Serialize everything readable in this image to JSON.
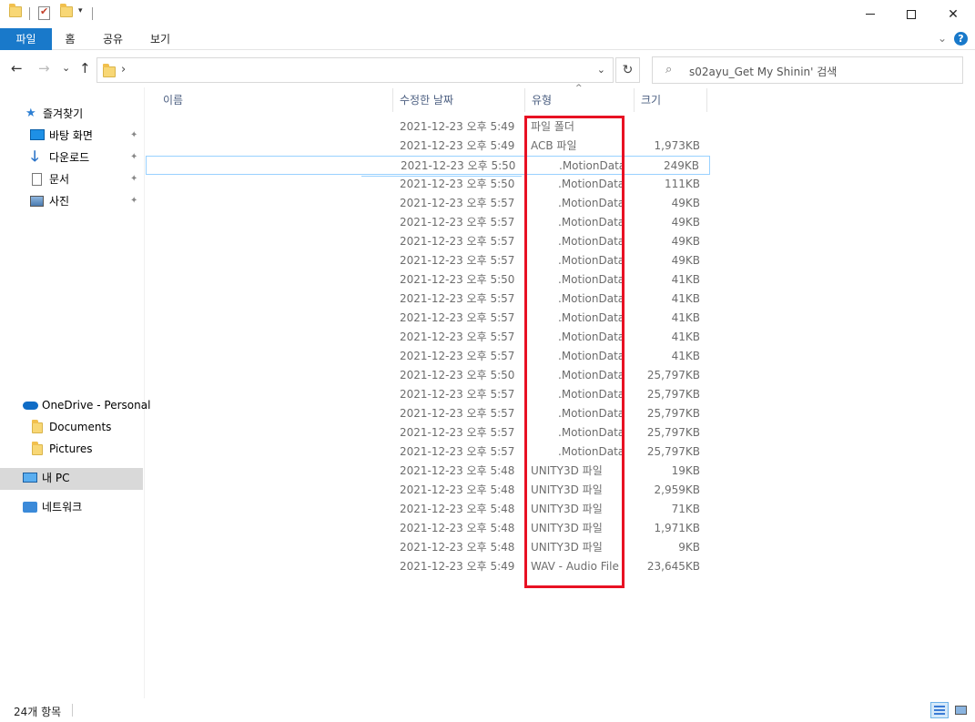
{
  "titlebar": {
    "qa_dropdown": "▾",
    "min_label": "",
    "close_label": "✕"
  },
  "ribbon": {
    "tabs": [
      {
        "label": "파일"
      },
      {
        "label": "홈"
      },
      {
        "label": "공유"
      },
      {
        "label": "보기"
      }
    ],
    "expand_glyph": "⌄",
    "help_glyph": "?"
  },
  "nav": {
    "back": "←",
    "forward": "→",
    "recent": "⌄",
    "up": "↑",
    "breadcrumb_chevron": "›",
    "address_dropdown": "⌄",
    "refresh": "↻",
    "search_glyph": "⌕",
    "search_placeholder": "s02ayu_Get My Shinin' 검색"
  },
  "sidebar": {
    "quick_access": "즐겨찾기",
    "pinned": [
      {
        "label": "바탕 화면",
        "icon": "desktop-icon"
      },
      {
        "label": "다운로드",
        "icon": "download-icon"
      },
      {
        "label": "문서",
        "icon": "document-icon"
      },
      {
        "label": "사진",
        "icon": "pictures-icon"
      }
    ],
    "pin_glyph": "📌",
    "onedrive": "OneDrive - Personal",
    "onedrive_children": [
      {
        "label": "Documents"
      },
      {
        "label": "Pictures"
      }
    ],
    "this_pc": "내 PC",
    "network": "네트워크"
  },
  "columns": {
    "name": "이름",
    "date": "수정한 날짜",
    "type": "유형",
    "size": "크기",
    "sort_glyph": "^"
  },
  "files": [
    {
      "date": "2021-12-23 오후 5:49",
      "type": "파일 폴더",
      "size": ""
    },
    {
      "date": "2021-12-23 오후 5:49",
      "type": "ACB 파일",
      "size": "1,973KB"
    },
    {
      "date": "2021-12-23 오후 5:50",
      "type": ".MotionData",
      "size": "249KB"
    },
    {
      "date": "2021-12-23 오후 5:50",
      "type": ".MotionData",
      "size": "111KB"
    },
    {
      "date": "2021-12-23 오후 5:57",
      "type": ".MotionData",
      "size": "49KB"
    },
    {
      "date": "2021-12-23 오후 5:57",
      "type": ".MotionData",
      "size": "49KB"
    },
    {
      "date": "2021-12-23 오후 5:57",
      "type": ".MotionData",
      "size": "49KB"
    },
    {
      "date": "2021-12-23 오후 5:57",
      "type": ".MotionData",
      "size": "49KB"
    },
    {
      "date": "2021-12-23 오후 5:50",
      "type": ".MotionData",
      "size": "41KB"
    },
    {
      "date": "2021-12-23 오후 5:57",
      "type": ".MotionData",
      "size": "41KB"
    },
    {
      "date": "2021-12-23 오후 5:57",
      "type": ".MotionData",
      "size": "41KB"
    },
    {
      "date": "2021-12-23 오후 5:57",
      "type": ".MotionData",
      "size": "41KB"
    },
    {
      "date": "2021-12-23 오후 5:57",
      "type": ".MotionData",
      "size": "41KB"
    },
    {
      "date": "2021-12-23 오후 5:50",
      "type": ".MotionData",
      "size": "25,797KB"
    },
    {
      "date": "2021-12-23 오후 5:57",
      "type": ".MotionData",
      "size": "25,797KB"
    },
    {
      "date": "2021-12-23 오후 5:57",
      "type": ".MotionData",
      "size": "25,797KB"
    },
    {
      "date": "2021-12-23 오후 5:57",
      "type": ".MotionData",
      "size": "25,797KB"
    },
    {
      "date": "2021-12-23 오후 5:57",
      "type": ".MotionData",
      "size": "25,797KB"
    },
    {
      "date": "2021-12-23 오후 5:48",
      "type": "UNITY3D 파일",
      "size": "19KB"
    },
    {
      "date": "2021-12-23 오후 5:48",
      "type": "UNITY3D 파일",
      "size": "2,959KB"
    },
    {
      "date": "2021-12-23 오후 5:48",
      "type": "UNITY3D 파일",
      "size": "71KB"
    },
    {
      "date": "2021-12-23 오후 5:48",
      "type": "UNITY3D 파일",
      "size": "1,971KB"
    },
    {
      "date": "2021-12-23 오후 5:48",
      "type": "UNITY3D 파일",
      "size": "9KB"
    },
    {
      "date": "2021-12-23 오후 5:49",
      "type": "WAV - Audio File",
      "size": "23,645KB"
    }
  ],
  "status": {
    "item_count": "24개 항목"
  },
  "colors": {
    "accent": "#1979ca",
    "highlight": "#e81123",
    "hover_border": "#99d1ff"
  }
}
